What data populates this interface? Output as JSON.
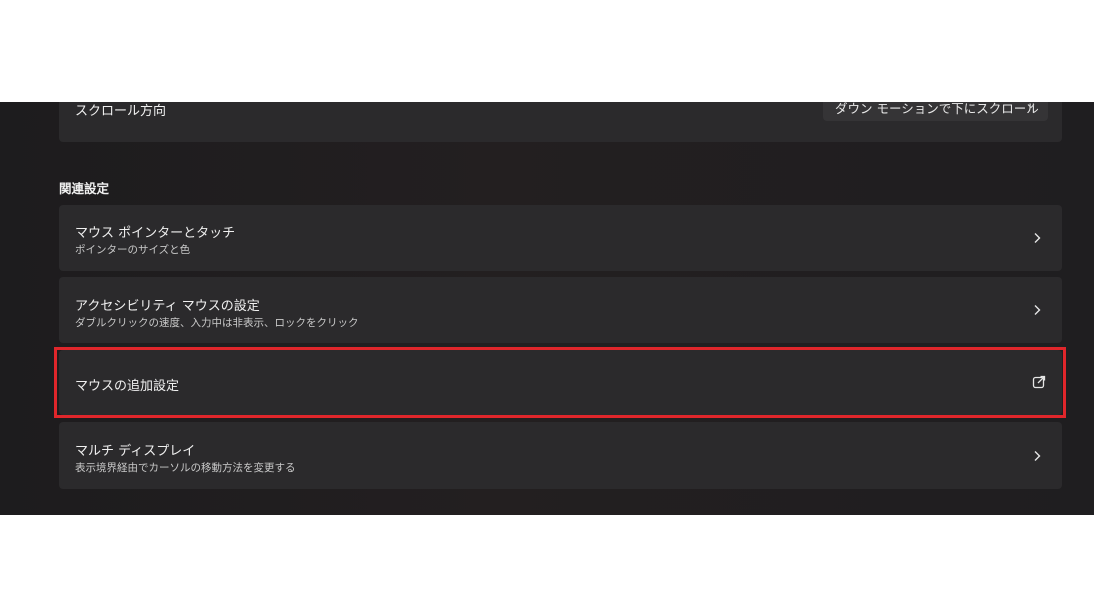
{
  "scroll_direction": {
    "label": "スクロール方向",
    "dropdown_value": "ダウン モーションで下にスクロール",
    "dropdown_icon": "chevron-down-icon"
  },
  "related_settings": {
    "header": "関連設定",
    "items": [
      {
        "title": "マウス ポインターとタッチ",
        "subtitle": "ポインターのサイズと色",
        "icon": "chevron-right-icon"
      },
      {
        "title": "アクセシビリティ マウスの設定",
        "subtitle": "ダブルクリックの速度、入力中は非表示、ロックをクリック",
        "icon": "chevron-right-icon"
      },
      {
        "title": "マウスの追加設定",
        "subtitle": "",
        "icon": "external-link-icon",
        "highlighted": true
      },
      {
        "title": "マルチ ディスプレイ",
        "subtitle": "表示境界経由でカーソルの移動方法を変更する",
        "icon": "chevron-right-icon"
      }
    ]
  },
  "colors": {
    "background": "#1f1e20",
    "card": "#2b2a2c",
    "highlight_border": "#e0262b",
    "text": "#f0f0f0"
  }
}
